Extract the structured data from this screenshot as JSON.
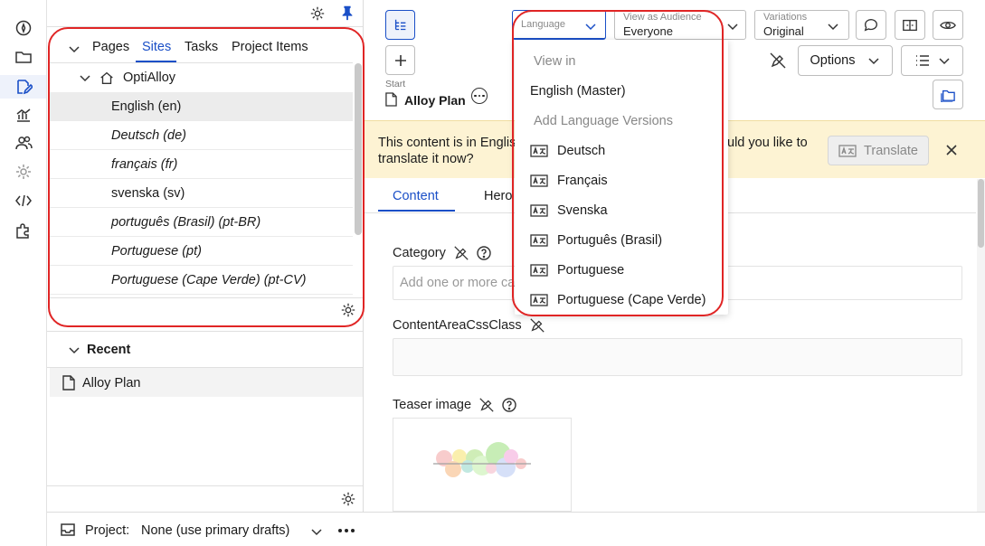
{
  "rail": {
    "icons": [
      "compass-icon",
      "folder-icon",
      "edit-icon",
      "chart-icon",
      "users-icon",
      "settings-icon",
      "code-icon",
      "puzzle-icon"
    ]
  },
  "tree": {
    "tabs": [
      "Pages",
      "Sites",
      "Tasks",
      "Project Items"
    ],
    "active_tab": "Sites",
    "site_root": "OptiAlloy",
    "languages": [
      {
        "label": "English (en)",
        "italic": false,
        "selected": true
      },
      {
        "label": "Deutsch (de)",
        "italic": true
      },
      {
        "label": "français (fr)",
        "italic": true
      },
      {
        "label": "svenska (sv)",
        "italic": false
      },
      {
        "label": "português (Brasil) (pt-BR)",
        "italic": true
      },
      {
        "label": "Portuguese (pt)",
        "italic": true
      },
      {
        "label": "Portuguese (Cape Verde) (pt-CV)",
        "italic": true
      }
    ],
    "recent_title": "Recent",
    "recent_items": [
      "Alloy Plan"
    ]
  },
  "project": {
    "label": "Project:",
    "value": "None (use primary drafts)"
  },
  "toolbar": {
    "language_label": "Language",
    "audience_label": "View as Audience",
    "audience_value": "Everyone",
    "variations_label": "Variations",
    "variations_value": "Original",
    "options_label": "Options"
  },
  "breadcrumb": {
    "start": "Start",
    "title": "Alloy Plan"
  },
  "banner": {
    "line1": "This content is in Englis",
    "line1_tail": "uld you like to",
    "line2": "translate it now?",
    "translate_label": "Translate"
  },
  "content_tabs": [
    "Content",
    "Hero"
  ],
  "fields": {
    "category_label": "Category",
    "category_placeholder": "Add one or more ca",
    "css_label": "ContentAreaCssClass",
    "teaser_label": "Teaser image"
  },
  "language_menu": {
    "view_in_header": "View in",
    "master": "English (Master)",
    "versions_header": "Add Language Versions",
    "versions": [
      "Deutsch",
      "Français",
      "Svenska",
      "Português (Brasil)",
      "Portuguese",
      "Portuguese (Cape Verde)"
    ]
  },
  "colors": {
    "accent": "#1a4fc7",
    "highlight": "#e02525",
    "banner": "#fdf3d3"
  }
}
